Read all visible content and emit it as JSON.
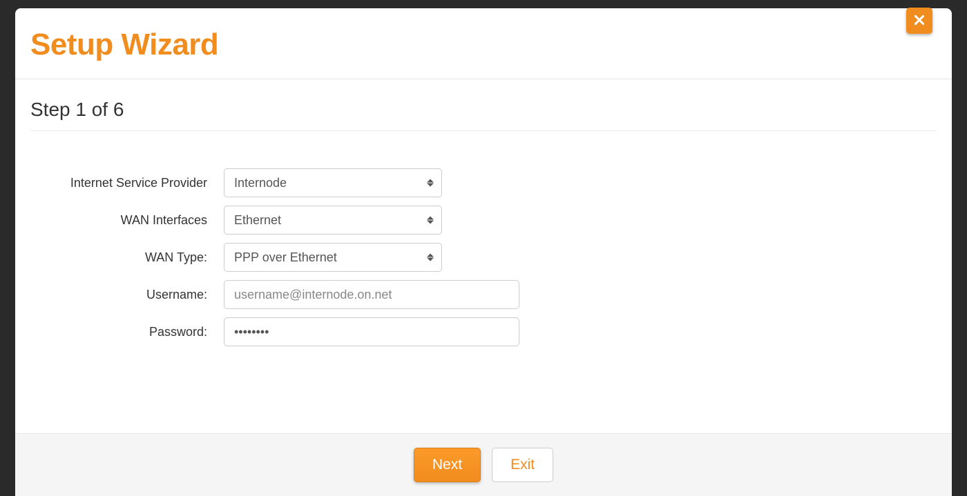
{
  "modal": {
    "title": "Setup Wizard",
    "step_label": "Step 1 of 6"
  },
  "form": {
    "isp": {
      "label": "Internet Service Provider",
      "value": "Internode"
    },
    "wan_iface": {
      "label": "WAN Interfaces",
      "value": "Ethernet"
    },
    "wan_type": {
      "label": "WAN Type:",
      "value": "PPP over Ethernet"
    },
    "username": {
      "label": "Username:",
      "placeholder": "username@internode.on.net",
      "value": ""
    },
    "password": {
      "label": "Password:",
      "value": "••••••••"
    }
  },
  "buttons": {
    "next": "Next",
    "exit": "Exit"
  }
}
